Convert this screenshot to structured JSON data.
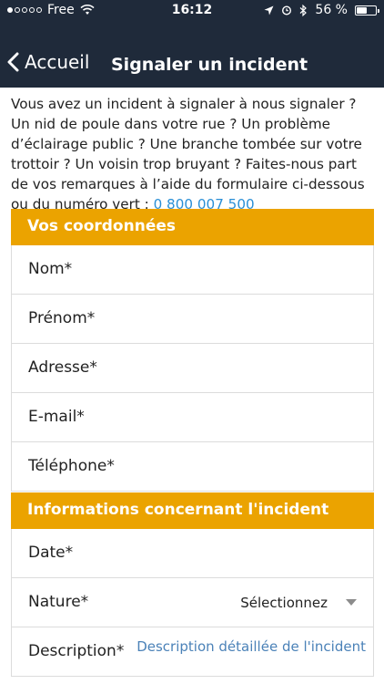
{
  "status": {
    "carrier": "Free",
    "time": "16:12",
    "battery": "56 %",
    "battery_level": 0.56
  },
  "nav": {
    "back_label": "Accueil",
    "title": "Signaler un incident"
  },
  "intro": {
    "text": "Vous avez un incident à signaler à nous signaler ? Un nid de poule dans votre rue ? Un problème d’éclairage public ? Une branche tombée sur votre trottoir ? Un voisin trop bruyant ? Faites-nous part de vos remarques à l’aide du formulaire ci-dessous ou du numéro vert : ",
    "phone": "0 800 007 500"
  },
  "sections": {
    "contact": {
      "title": "Vos coordonnées",
      "fields": {
        "nom": "Nom*",
        "prenom": "Prénom*",
        "adresse": "Adresse*",
        "email": "E-mail*",
        "telephone": "Téléphone*"
      }
    },
    "incident": {
      "title": "Informations concernant l'incident",
      "fields": {
        "date": "Date*",
        "nature": "Nature*",
        "nature_value": "Sélectionnez",
        "description": "Description*",
        "description_placeholder": "Description détaillée de l'incident"
      }
    }
  },
  "colors": {
    "header": "#1f2a3a",
    "section": "#eba300",
    "link": "#2a8fd6"
  }
}
